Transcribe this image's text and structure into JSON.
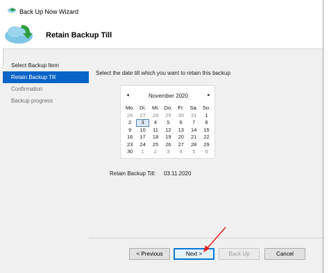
{
  "window": {
    "title": "Back Up Now Wizard"
  },
  "header": {
    "title": "Retain Backup Till"
  },
  "nav": {
    "items": [
      {
        "label": "Select Backup Item",
        "state": "normal"
      },
      {
        "label": "Retain Backup Till",
        "state": "active"
      },
      {
        "label": "Confirmation",
        "state": "dim"
      },
      {
        "label": "Backup progress",
        "state": "dim"
      }
    ]
  },
  "main": {
    "instruction": "Select the date till which you want to retain this backup",
    "calendar": {
      "prev": "◂",
      "next": "▸",
      "month_label": "November 2020",
      "weekdays": [
        "Mo.",
        "Di.",
        "Mi.",
        "Do.",
        "Fr.",
        "Sa.",
        "So."
      ],
      "weeks": [
        [
          "26",
          "27",
          "28",
          "29",
          "30",
          "31",
          "1"
        ],
        [
          "2",
          "3",
          "4",
          "5",
          "6",
          "7",
          "8"
        ],
        [
          "9",
          "10",
          "11",
          "12",
          "13",
          "14",
          "15"
        ],
        [
          "16",
          "17",
          "18",
          "19",
          "20",
          "21",
          "22"
        ],
        [
          "23",
          "24",
          "25",
          "26",
          "27",
          "28",
          "29"
        ],
        [
          "30",
          "1",
          "2",
          "3",
          "4",
          "5",
          "6"
        ]
      ],
      "selected_day": "3"
    },
    "retain_label": "Retain Backup Till:",
    "retain_value": "03.11.2020"
  },
  "buttons": {
    "previous": "< Previous",
    "next": "Next >",
    "backup": "Back Up",
    "cancel": "Cancel"
  },
  "colors": {
    "accent": "#0a64c7",
    "annotation_arrow": "#e02020"
  }
}
